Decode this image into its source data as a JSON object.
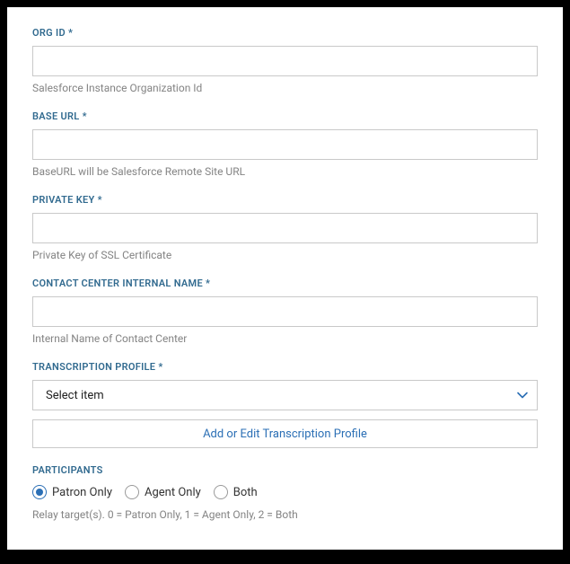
{
  "fields": {
    "org_id": {
      "label": "ORG ID *",
      "value": "",
      "help": "Salesforce Instance Organization Id"
    },
    "base_url": {
      "label": "BASE URL *",
      "value": "",
      "help": "BaseURL will be Salesforce Remote Site URL"
    },
    "private_key": {
      "label": "PRIVATE KEY *",
      "value": "",
      "help": "Private Key of SSL Certificate"
    },
    "contact_center": {
      "label": "CONTACT CENTER INTERNAL NAME *",
      "value": "",
      "help": "Internal Name of Contact Center"
    },
    "transcription_profile": {
      "label": "TRANSCRIPTION PROFILE *",
      "selected": "Select item",
      "button": "Add or Edit Transcription Profile"
    }
  },
  "participants": {
    "label": "PARTICIPANTS",
    "options": [
      {
        "label": "Patron Only",
        "selected": true
      },
      {
        "label": "Agent Only",
        "selected": false
      },
      {
        "label": "Both",
        "selected": false
      }
    ],
    "help": "Relay target(s). 0 = Patron Only, 1 = Agent Only, 2 = Both"
  }
}
